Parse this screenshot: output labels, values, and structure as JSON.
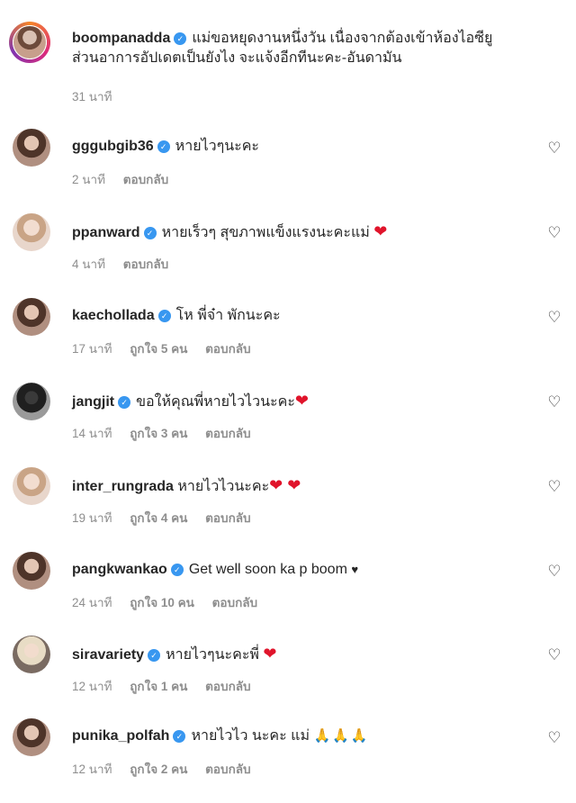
{
  "caption": {
    "username": "boompanadda",
    "text_line1": "แม่ขอหยุดงานหนึ่งวัน เนื่องจากต้องเข้าห้องไอซียู",
    "text_line2": "ส่วนอาการอัปเดตเป็นยังไง จะแจ้งอีกทีนะคะ-อันดามัน",
    "time": "31 นาที"
  },
  "labels": {
    "reply": "ตอบกลับ",
    "verified_mark": "✓",
    "like_icon": "♡"
  },
  "comments": [
    {
      "username": "gggubgib36",
      "verified": true,
      "text": "หายไวๆนะคะ",
      "emoji": "",
      "time": "2 นาที",
      "likes": ""
    },
    {
      "username": "ppanward",
      "verified": true,
      "text": "หายเร็วๆ สุขภาพแข็งแรงนะคะแม่",
      "emoji": "❤",
      "time": "4 นาที",
      "likes": ""
    },
    {
      "username": "kaechollada",
      "verified": true,
      "text": "โห พี่จ๋า พักนะคะ",
      "emoji": "",
      "time": "17 นาที",
      "likes": "ถูกใจ 5 คน"
    },
    {
      "username": "jangjit",
      "verified": true,
      "text": "ขอให้คุณพี่หายไวไวนะคะ",
      "emoji": "❤",
      "time": "14 นาที",
      "likes": "ถูกใจ 3 คน"
    },
    {
      "username": "inter_rungrada",
      "verified": false,
      "text": "หายไวไวนะคะ",
      "emoji": "❤ ❤",
      "time": "19 นาที",
      "likes": "ถูกใจ 4 คน"
    },
    {
      "username": "pangkwankao",
      "verified": true,
      "text": "Get well soon ka p boom",
      "emoji": "♥",
      "time": "24 นาที",
      "likes": "ถูกใจ 10 คน"
    },
    {
      "username": "siravariety",
      "verified": true,
      "text": "หายไวๆนะคะพี่",
      "emoji": "❤",
      "time": "12 นาที",
      "likes": "ถูกใจ 1 คน"
    },
    {
      "username": "punika_polfah",
      "verified": true,
      "text": "หายไวไว นะคะ แม่",
      "emoji": "🙏🙏🙏",
      "time": "12 นาที",
      "likes": "ถูกใจ 2 คน"
    }
  ],
  "colors": {
    "verified": "#3897f0",
    "heart_emoji": "#e0142b",
    "muted": "#8e8e8e",
    "text": "#262626"
  }
}
